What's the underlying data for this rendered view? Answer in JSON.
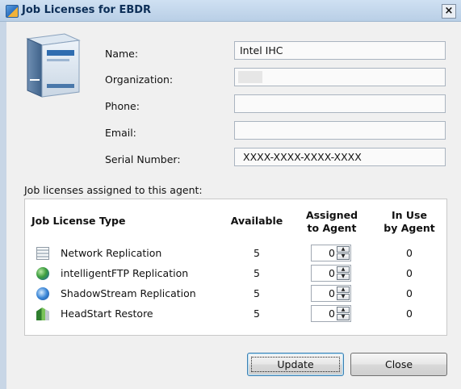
{
  "window": {
    "title": "Job Licenses for EBDR",
    "close_glyph": "×"
  },
  "form": {
    "name_label": "Name:",
    "name_value": "Intel IHC",
    "organization_label": "Organization:",
    "organization_value": "",
    "phone_label": "Phone:",
    "phone_value": "",
    "email_label": "Email:",
    "email_value": "",
    "serial_label": "Serial Number:",
    "serial_value": "XXXX-XXXX-XXXX-XXXX"
  },
  "licenses": {
    "caption": "Job licenses assigned to this agent:",
    "headers": {
      "type": "Job License Type",
      "available": "Available",
      "assigned_line1": "Assigned",
      "assigned_line2": "to Agent",
      "inuse_line1": "In Use",
      "inuse_line2": "by Agent"
    },
    "rows": [
      {
        "icon": "network-replication-icon",
        "name": "Network Replication",
        "available": "5",
        "assigned": "0",
        "in_use": "0"
      },
      {
        "icon": "intelligentftp-globe-icon",
        "name": "intelligentFTP Replication",
        "available": "5",
        "assigned": "0",
        "in_use": "0"
      },
      {
        "icon": "shadowstream-globe-icon",
        "name": "ShadowStream Replication",
        "available": "5",
        "assigned": "0",
        "in_use": "0"
      },
      {
        "icon": "headstart-restore-icon",
        "name": "HeadStart Restore",
        "available": "5",
        "assigned": "0",
        "in_use": "0"
      }
    ]
  },
  "buttons": {
    "update": "Update",
    "close": "Close"
  }
}
